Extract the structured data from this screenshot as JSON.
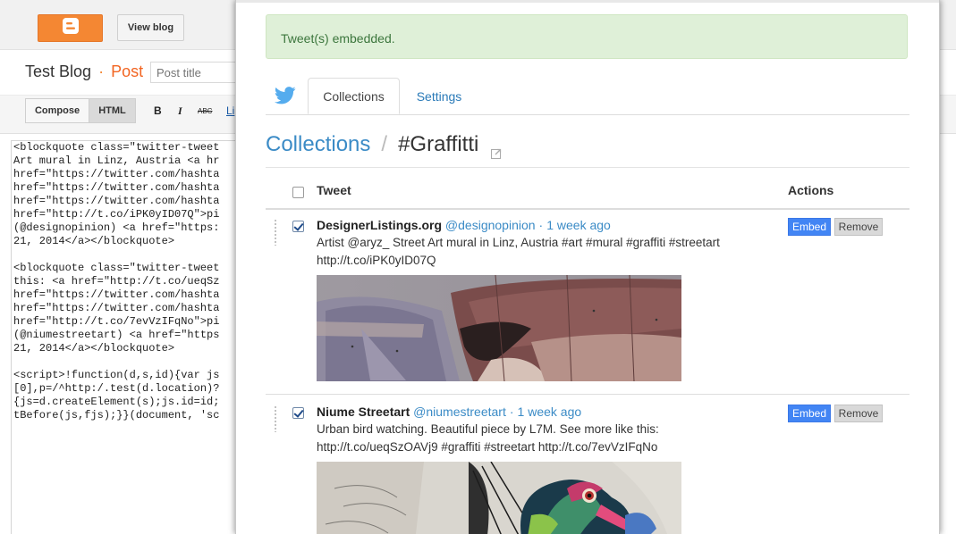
{
  "header": {
    "view_blog_label": "View blog"
  },
  "editor": {
    "blog_name": "Test Blog",
    "separator": "·",
    "section": "Post",
    "post_title_placeholder": "Post title",
    "compose_label": "Compose",
    "html_label": "HTML",
    "bold_label": "B",
    "italic_label": "I",
    "strike_label": "ABC",
    "link_label": "Li",
    "code_lines": [
      "<blockquote class=\"twitter-tweet",
      "Art mural in Linz, Austria <a hr",
      "href=\"https://twitter.com/hashta",
      "href=\"https://twitter.com/hashta",
      "href=\"https://twitter.com/hashta",
      "href=\"http://t.co/iPK0yID07Q\">pi",
      "(@designopinion) <a href=\"https:",
      "21, 2014</a></blockquote>",
      "",
      "<blockquote class=\"twitter-tweet",
      "this: <a href=\"http://t.co/ueqSz",
      "href=\"https://twitter.com/hashta",
      "href=\"https://twitter.com/hashta",
      "href=\"http://t.co/7evVzIFqNo\">pi",
      "(@niumestreetart) <a href=\"https",
      "21, 2014</a></blockquote>",
      "",
      "<script>!function(d,s,id){var js",
      "[0],p=/^http:/.test(d.location)?",
      "{js=d.createElement(s);js.id=id;",
      "tBefore(js,fjs);}}(document, 'sc"
    ]
  },
  "modal": {
    "alert_text": "Tweet(s) embedded.",
    "tabs": [
      {
        "label": "Collections",
        "active": true
      },
      {
        "label": "Settings",
        "active": false
      }
    ],
    "breadcrumb": {
      "parent": "Collections",
      "separator": "/",
      "current": "#Graffitti"
    },
    "table": {
      "col_tweet": "Tweet",
      "col_actions": "Actions",
      "select_all_checked": false,
      "rows": [
        {
          "checked": true,
          "name": "DesignerListings.org",
          "handle": "@designopinion",
          "sep": "·",
          "time": "1 week ago",
          "text_line1": "Artist @aryz_ Street Art mural in Linz, Austria #art #mural #graffiti #streetart",
          "text_line2": "http://t.co/iPK0yID07Q",
          "embed_label": "Embed",
          "remove_label": "Remove"
        },
        {
          "checked": true,
          "name": "Niume Streetart",
          "handle": "@niumestreetart",
          "sep": "·",
          "time": "1 week ago",
          "text_line1": "Urban bird watching. Beautiful piece by L7M. See more like this:",
          "text_line2": "http://t.co/ueqSzOAVj9 #graffiti #streetart http://t.co/7evVzIFqNo",
          "embed_label": "Embed",
          "remove_label": "Remove"
        }
      ]
    }
  },
  "colors": {
    "blogger_orange": "#f48733",
    "twitter_blue": "#55acee",
    "link_blue": "#3b8bc6",
    "embed_blue": "#4285f4",
    "alert_bg": "#dff0d8",
    "alert_text": "#3c763d"
  },
  "icons": [
    "blogger-logo-icon",
    "twitter-bird-icon",
    "external-link-icon"
  ]
}
